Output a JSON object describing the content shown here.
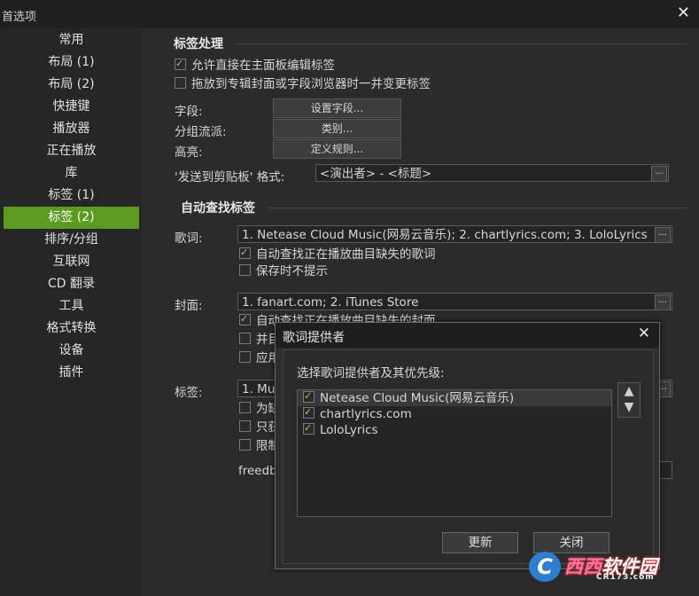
{
  "window": {
    "title": "首选项",
    "close_glyph": "✕"
  },
  "sidebar": {
    "items": [
      "常用",
      "布局 (1)",
      "布局 (2)",
      "快捷键",
      "播放器",
      "正在播放",
      "库",
      "标签 (1)",
      "标签 (2)",
      "排序/分组",
      "互联网",
      "CD 翻录",
      "工具",
      "格式转换",
      "设备",
      "插件"
    ],
    "active_index": 8
  },
  "tag_processing": {
    "title": "标签处理",
    "allow_edit": {
      "label": "允许直接在主面板编辑标签",
      "checked": true
    },
    "drag_drop": {
      "label": "拖放到专辑封面或字段浏览器时一并变更标签",
      "checked": false
    },
    "fields_label": "字段:",
    "fields_button": "设置字段...",
    "grouping_label": "分组流派:",
    "grouping_button": "类别...",
    "highlight_label": "高亮:",
    "highlight_button": "定义规则...",
    "clipboard_label": "'发送到剪贴板' 格式:",
    "clipboard_value": "<演出者> - <标题>"
  },
  "auto_tag": {
    "title": "自动查找标签",
    "lyrics_label": "歌词:",
    "lyrics_value": "1. Netease Cloud Music(网易云音乐); 2. chartlyrics.com; 3. LoloLyrics",
    "lyrics_opt1": {
      "label": "自动查找正在播放曲目缺失的歌词",
      "checked": true
    },
    "lyrics_opt2": {
      "label": "保存时不提示",
      "checked": false
    },
    "cover_label": "封面:",
    "cover_value": "1. fanart.com; 2. iTunes Store",
    "cover_opt1": {
      "label": "自动查找正在播放曲目缺失的封面",
      "checked": true
    },
    "cover_opt2": {
      "label": "并目",
      "checked": false
    },
    "cover_opt3": {
      "label": "应用",
      "checked": false
    },
    "tags_label": "标签:",
    "tags_value": "1. Mus",
    "tags_opt1": {
      "label": "为缺",
      "checked": false
    },
    "tags_opt2": {
      "label": "只获",
      "checked": false
    },
    "tags_opt3": {
      "label": "限制",
      "checked": false
    },
    "freedb_label": "freedb"
  },
  "dialog": {
    "title": "歌词提供者",
    "close_glyph": "✕",
    "prompt": "选择歌词提供者及其优先级:",
    "providers": [
      {
        "name": "Netease Cloud Music(网易云音乐)",
        "checked": true
      },
      {
        "name": "chartlyrics.com",
        "checked": true
      },
      {
        "name": "LoloLyrics",
        "checked": true
      }
    ],
    "up_arrow": "▲",
    "down_arrow": "▼",
    "update_button": "更新",
    "close_button": "关闭"
  },
  "ellipsis": "...",
  "watermark": {
    "logo": "C",
    "text_a": "西西",
    "text_b": "软件园",
    "sub": "CR173.com"
  },
  "colors": {
    "accent": "#5a9b20"
  }
}
